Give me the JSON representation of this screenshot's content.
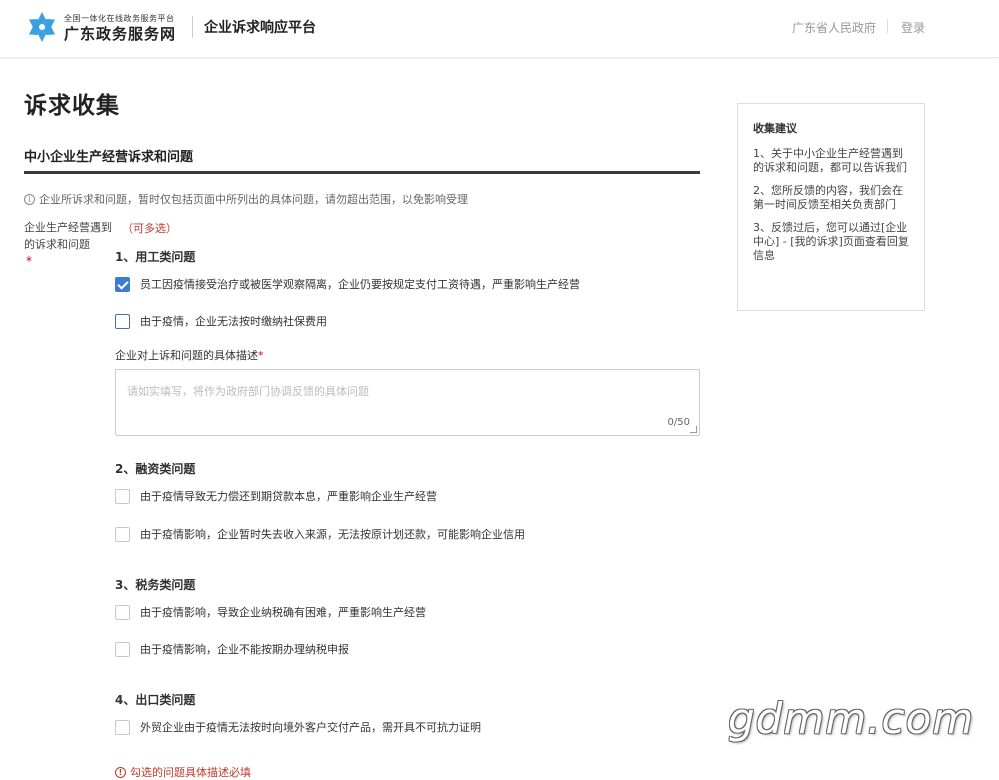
{
  "header": {
    "brand_small": "全国一体化在线政务服务平台",
    "brand_name": "广东政务服务网",
    "platform_title": "企业诉求响应平台",
    "gov_link": "广东省人民政府",
    "login_label": "登录",
    "logo_icon": "snowflake-logo-icon",
    "logo_color": "#3aa0e0"
  },
  "page": {
    "title": "诉求收集",
    "section_title": "中小企业生产经营诉求和问题",
    "notice": "企业所诉求和问题，暂时仅包括页面中所列出的具体问题，请勿超出范围，以免影响受理"
  },
  "field": {
    "label": "企业生产经营遇到的诉求和问题",
    "required_mark": "*",
    "multi_hint": "（可多选）"
  },
  "categories": [
    {
      "title": "1、用工类问题",
      "options": [
        {
          "label": "员工因疫情接受治疗或被医学观察隔离，企业仍要按规定支付工资待遇，严重影响生产经营",
          "checked": true
        },
        {
          "label": "由于疫情，企业无法按时缴纳社保费用",
          "checked": false
        }
      ]
    },
    {
      "title": "2、融资类问题",
      "options": [
        {
          "label": "由于疫情导致无力偿还到期贷款本息，严重影响企业生产经营",
          "checked": false
        },
        {
          "label": "由于疫情影响，企业暂时失去收入来源，无法按原计划还款，可能影响企业信用",
          "checked": false
        }
      ]
    },
    {
      "title": "3、税务类问题",
      "options": [
        {
          "label": "由于疫情影响，导致企业纳税确有困难，严重影响生产经营",
          "checked": false
        },
        {
          "label": "由于疫情影响，企业不能按期办理纳税申报",
          "checked": false
        }
      ]
    },
    {
      "title": "4、出口类问题",
      "options": [
        {
          "label": "外贸企业由于疫情无法按时向境外客户交付产品，需开具不可抗力证明",
          "checked": false
        }
      ]
    }
  ],
  "description": {
    "label": "企业对上诉和问题的具体描述",
    "required_mark": "*",
    "placeholder": "请如实填写，将作为政府部门协调反馈的具体问题",
    "counter": "0/50"
  },
  "validation": {
    "error": "勾选的问题具体描述必填"
  },
  "tips": {
    "title": "收集建议",
    "items": [
      "1、关于中小企业生产经营遇到的诉求和问题，都可以告诉我们",
      "2、您所反馈的内容，我们会在第一时间反馈至相关负责部门",
      "3、反馈过后，您可以通过[企业中心] - [我的诉求]页面查看回复信息"
    ]
  },
  "watermark": "gdmm.com",
  "colors": {
    "accent": "#3d7bd1",
    "required": "#d9001b",
    "hint": "#c0392b"
  }
}
